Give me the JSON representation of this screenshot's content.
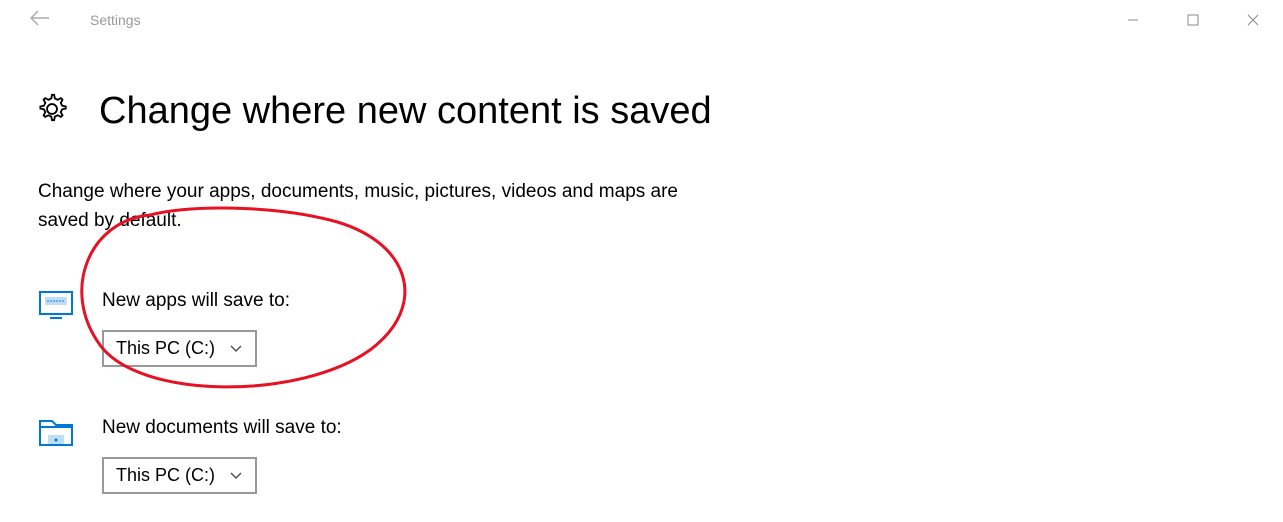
{
  "titlebar": {
    "app_name": "Settings"
  },
  "page": {
    "title": "Change where new content is saved",
    "description": "Change where your apps, documents, music, pictures, videos and maps are saved by default."
  },
  "settings": {
    "apps": {
      "label": "New apps will save to:",
      "value": "This PC (C:)"
    },
    "documents": {
      "label": "New documents will save to:",
      "value": "This PC (C:)"
    }
  }
}
